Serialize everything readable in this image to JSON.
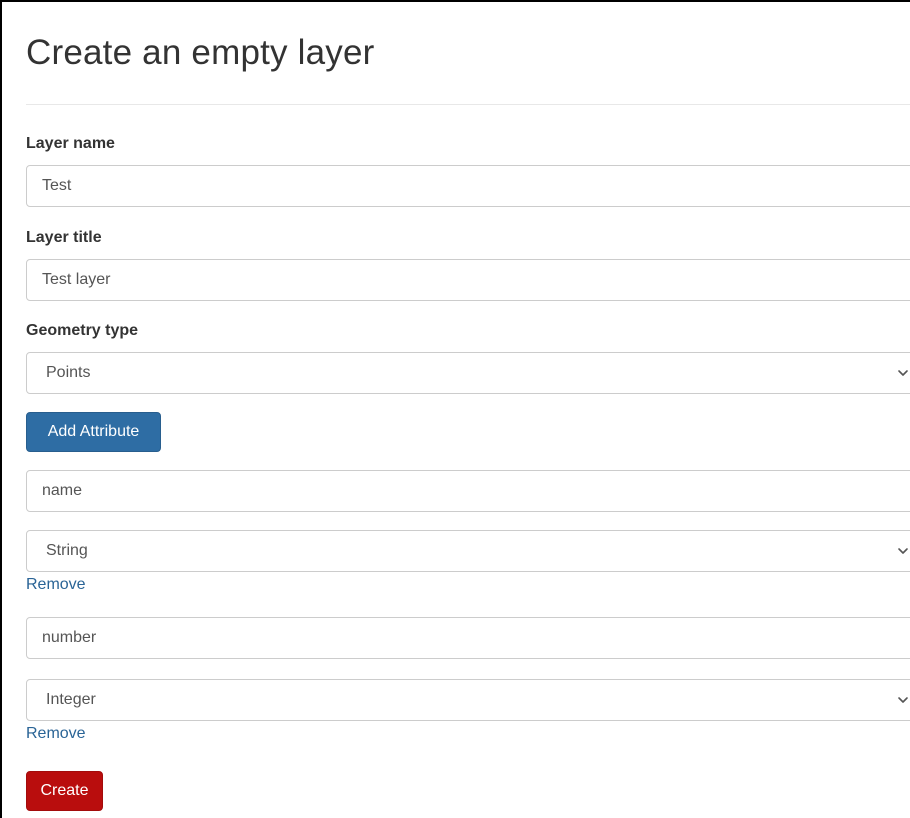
{
  "page": {
    "title": "Create an empty layer"
  },
  "form": {
    "layer_name": {
      "label": "Layer name",
      "value": "Test"
    },
    "layer_title": {
      "label": "Layer title",
      "value": "Test layer"
    },
    "geometry_type": {
      "label": "Geometry type",
      "selected": "Points"
    },
    "add_attribute_label": "Add Attribute",
    "attributes": [
      {
        "name": "name",
        "type": "String",
        "remove_label": "Remove"
      },
      {
        "name": "number",
        "type": "Integer",
        "remove_label": "Remove"
      }
    ],
    "create_label": "Create"
  },
  "icons": {
    "select_indicator": "chevron-down-icon"
  },
  "colors": {
    "primary_button": "#2e6da4",
    "danger_button": "#b90d0d",
    "link": "#2a6496"
  }
}
